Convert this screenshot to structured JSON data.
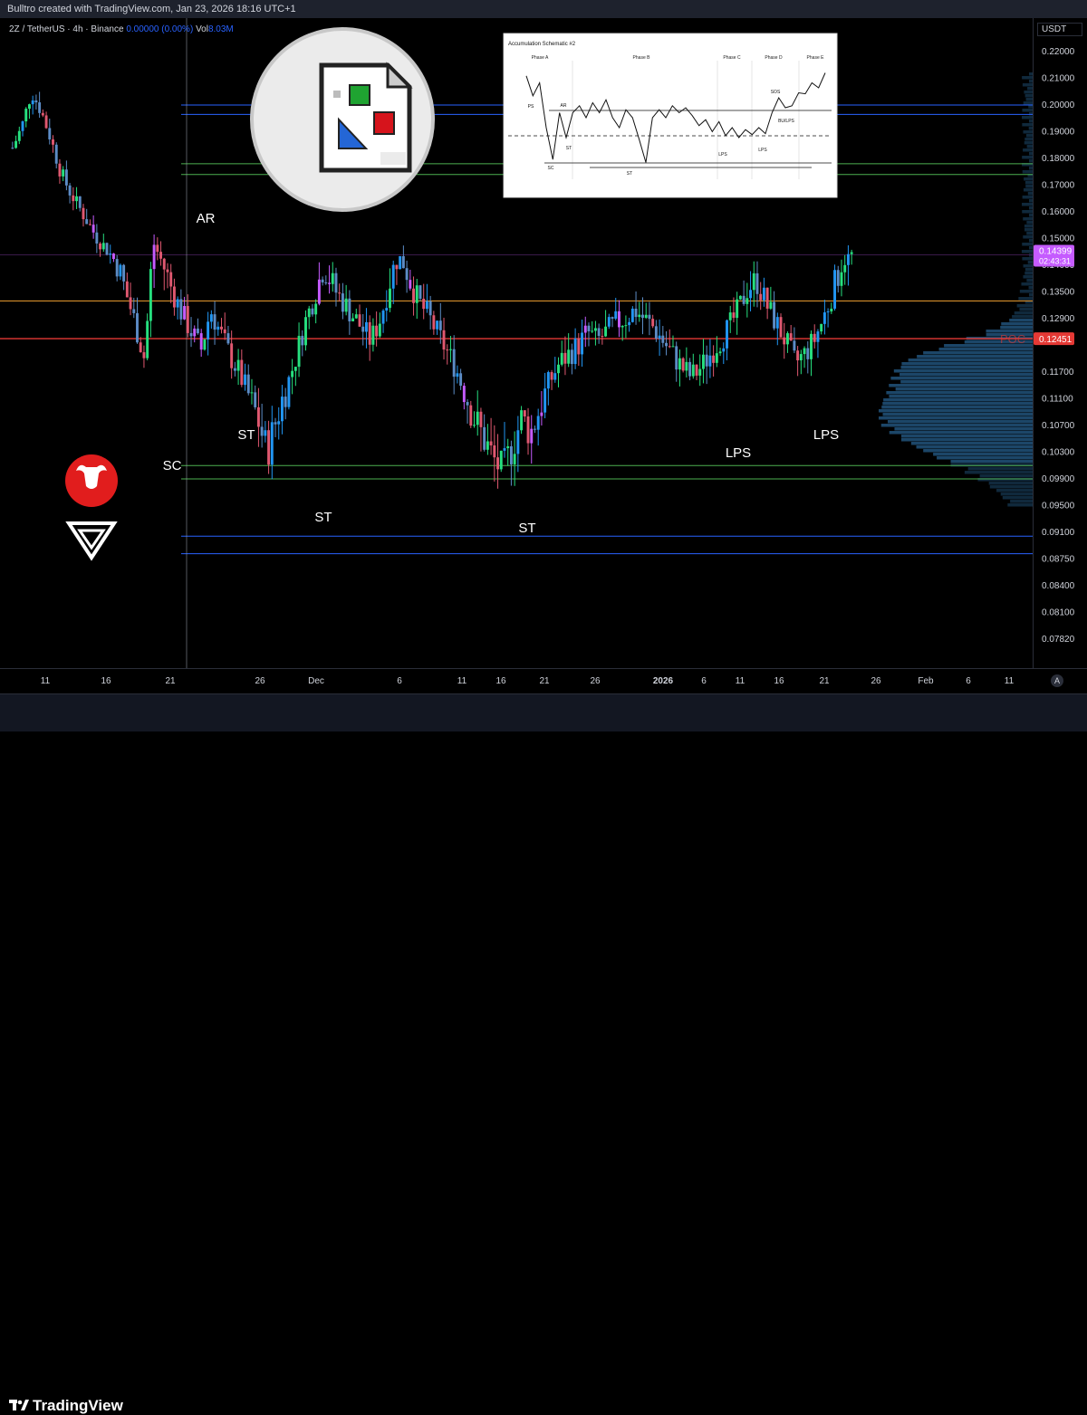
{
  "header": {
    "text": "Bulltro created with TradingView.com, Jan 23, 2026 18:16 UTC+1"
  },
  "legend": {
    "symbol": "2Z / TetherUS · 4h · Binance",
    "price": "0.00000",
    "change": "(0.00%)",
    "vol_label": "Vol",
    "vol_value": "8.03M"
  },
  "axis": {
    "currency": "USDT"
  },
  "footer": {
    "brand": "TradingView",
    "auto_button": "A"
  },
  "colors": {
    "up": "#26e07f",
    "down": "#e05870",
    "up_alt": "#2196f3",
    "down_alt": "#5c8cc6",
    "purple": "#c55bff",
    "poc": "#e53935",
    "orange": "#f0a030",
    "green_line": "#4caf50",
    "blue_line": "#2962ff",
    "profile": "#1e4a6e"
  },
  "chart_data": {
    "type": "candlestick",
    "symbol": "2Z / TetherUS",
    "interval": "4h",
    "exchange": "Binance",
    "ylim": [
      0.0765,
      0.2265
    ],
    "price_ticks": [
      "0.22000",
      "0.21000",
      "0.20000",
      "0.19000",
      "0.18000",
      "0.17000",
      "0.16000",
      "0.15000",
      "0.14000",
      "0.13500",
      "0.12900",
      "0.12300",
      "0.11700",
      "0.11100",
      "0.10700",
      "0.10300",
      "0.09900",
      "0.09500",
      "0.09100",
      "0.08750",
      "0.08400",
      "0.08100",
      "0.07820"
    ],
    "time_ticks": [
      "11",
      "16",
      "21",
      "26",
      "Dec",
      "6",
      "11",
      "16",
      "21",
      "26",
      "2026",
      "6",
      "11",
      "16",
      "21",
      "26",
      "Feb",
      "6",
      "11"
    ],
    "current_price": {
      "value": "0.14399",
      "countdown": "02:43:31"
    },
    "poc": {
      "label": "POC",
      "value": "0.12451"
    },
    "levels": [
      {
        "name": "blue-upper-1",
        "price": 0.2
      },
      {
        "name": "blue-upper-2",
        "price": 0.1965
      },
      {
        "name": "green-upper-1",
        "price": 0.178
      },
      {
        "name": "green-upper-2",
        "price": 0.174
      },
      {
        "name": "orange-mid",
        "price": 0.133
      },
      {
        "name": "poc",
        "price": 0.12451
      },
      {
        "name": "green-lower-1",
        "price": 0.101
      },
      {
        "name": "green-lower-2",
        "price": 0.099
      },
      {
        "name": "blue-lower-1",
        "price": 0.0905
      },
      {
        "name": "blue-lower-2",
        "price": 0.0882
      }
    ],
    "annotations": [
      {
        "label": "AR"
      },
      {
        "label": "SC"
      },
      {
        "label": "ST"
      },
      {
        "label": "ST"
      },
      {
        "label": "ST"
      },
      {
        "label": "LPS"
      },
      {
        "label": "LPS"
      }
    ],
    "price_path": [
      0.184,
      0.192,
      0.205,
      0.198,
      0.188,
      0.176,
      0.168,
      0.162,
      0.156,
      0.15,
      0.146,
      0.141,
      0.135,
      0.128,
      0.12,
      0.148,
      0.14,
      0.135,
      0.13,
      0.126,
      0.122,
      0.131,
      0.126,
      0.121,
      0.117,
      0.112,
      0.108,
      0.103,
      0.108,
      0.113,
      0.12,
      0.128,
      0.134,
      0.14,
      0.136,
      0.133,
      0.13,
      0.127,
      0.124,
      0.129,
      0.137,
      0.143,
      0.138,
      0.133,
      0.13,
      0.126,
      0.122,
      0.118,
      0.112,
      0.108,
      0.105,
      0.102,
      0.1,
      0.104,
      0.108,
      0.106,
      0.11,
      0.115,
      0.119,
      0.121,
      0.123,
      0.126,
      0.124,
      0.126,
      0.128,
      0.129,
      0.131,
      0.129,
      0.127,
      0.124,
      0.121,
      0.118,
      0.116,
      0.118,
      0.121,
      0.124,
      0.127,
      0.131,
      0.136,
      0.137,
      0.132,
      0.128,
      0.124,
      0.119,
      0.121,
      0.124,
      0.129,
      0.135,
      0.141,
      0.144
    ],
    "inset": {
      "title": "Accumulation Schematic #2",
      "phases": [
        "Phase A",
        "Phase B",
        "Phase C",
        "Phase D",
        "Phase E"
      ],
      "labels": [
        "PS",
        "AR",
        "SC",
        "ST",
        "ST",
        "LPS",
        "LPS",
        "SOS",
        "BU/LPS"
      ],
      "path": [
        0.92,
        0.72,
        0.85,
        0.4,
        0.08,
        0.55,
        0.3,
        0.55,
        0.62,
        0.5,
        0.65,
        0.55,
        0.68,
        0.5,
        0.4,
        0.58,
        0.5,
        0.28,
        0.05,
        0.5,
        0.58,
        0.5,
        0.62,
        0.55,
        0.6,
        0.52,
        0.42,
        0.48,
        0.36,
        0.46,
        0.32,
        0.4,
        0.3,
        0.38,
        0.33,
        0.4,
        0.34,
        0.55,
        0.7,
        0.6,
        0.62,
        0.75,
        0.74,
        0.85,
        0.8,
        0.95
      ]
    }
  }
}
